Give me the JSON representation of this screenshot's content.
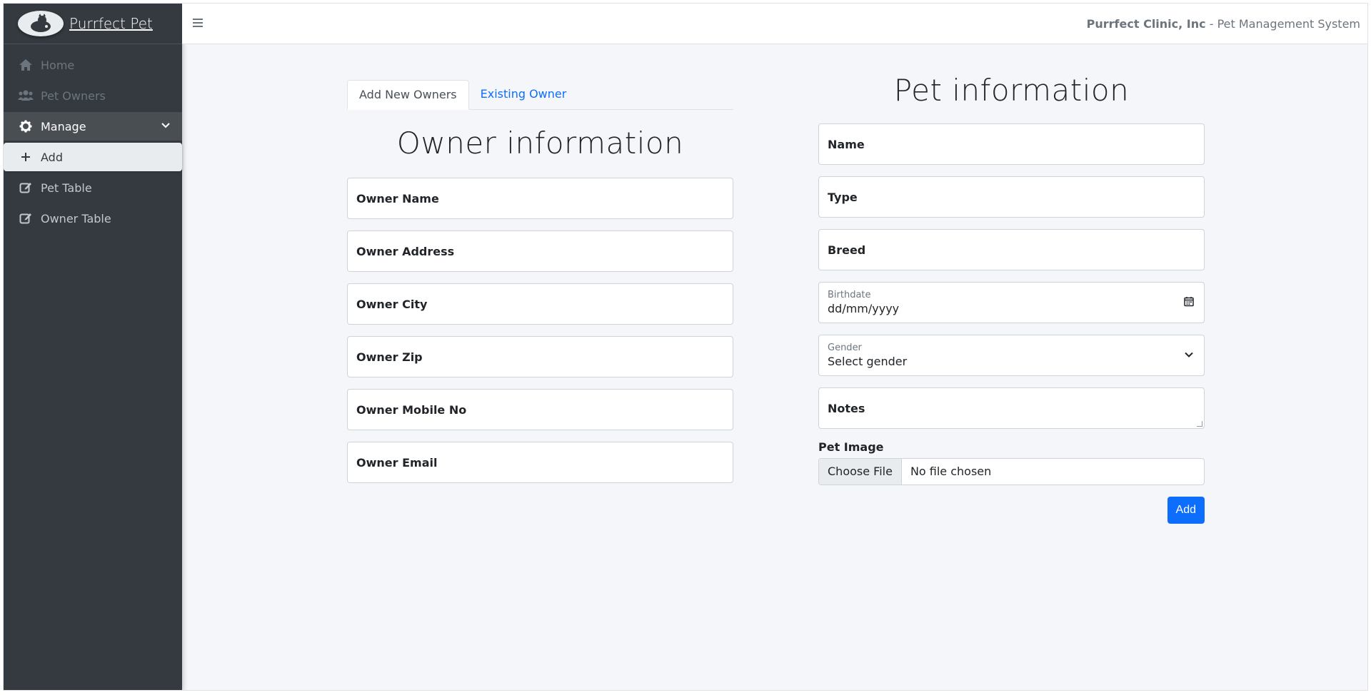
{
  "sidebar": {
    "brand": "Purrfect Pet",
    "items": [
      {
        "label": "Home",
        "icon": "home-icon"
      },
      {
        "label": "Pet Owners",
        "icon": "users-icon"
      },
      {
        "label": "Manage",
        "icon": "gear-icon"
      },
      {
        "label": "Add",
        "icon": "plus-icon"
      },
      {
        "label": "Pet Table",
        "icon": "edit-icon"
      },
      {
        "label": "Owner Table",
        "icon": "edit-icon"
      }
    ]
  },
  "header": {
    "company": "Purrfect Clinic, Inc",
    "system": " - Pet Management System"
  },
  "owner": {
    "tabs": [
      "Add New Owners",
      "Existing Owner"
    ],
    "title": "Owner information",
    "fields": [
      "Owner Name",
      "Owner Address",
      "Owner City",
      "Owner Zip",
      "Owner Mobile No",
      "Owner Email"
    ]
  },
  "pet": {
    "title": "Pet information",
    "name": "Name",
    "type": "Type",
    "breed": "Breed",
    "birthdate_label": "Birthdate",
    "birthdate_placeholder": "dd/mm/yyyy",
    "gender_label": "Gender",
    "gender_value": "Select gender",
    "notes": "Notes",
    "image_label": "Pet Image",
    "file_button": "Choose File",
    "file_status": "No file chosen",
    "add_button": "Add"
  },
  "colors": {
    "sidebar_bg": "#343a40",
    "primary": "#0d6efd",
    "content_bg": "#f4f6f9"
  }
}
